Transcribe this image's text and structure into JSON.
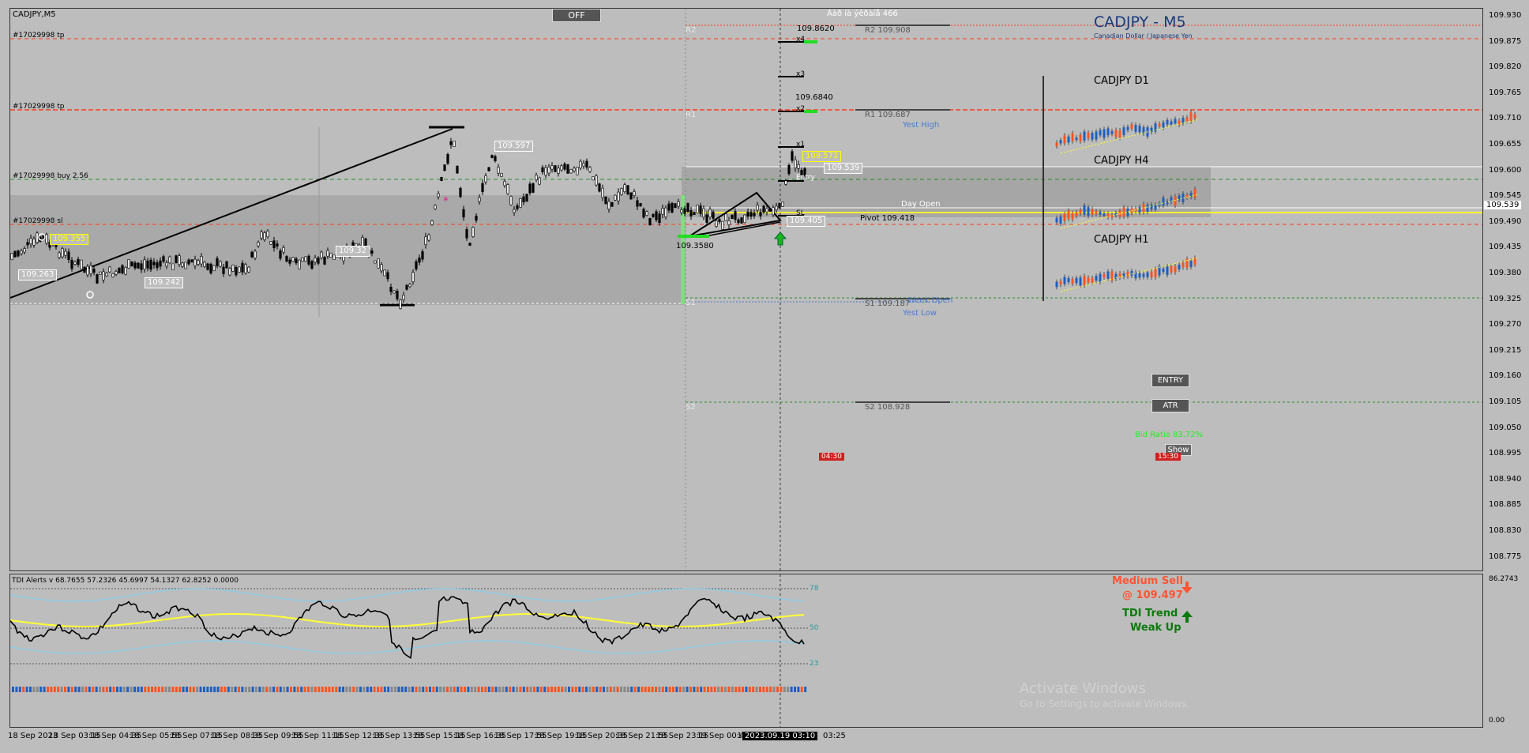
{
  "window": {
    "title": "CADJPY,M5"
  },
  "toolbar": {
    "off_button": "OFF",
    "header_text": "Áàð íà ýêðàíå 466"
  },
  "symbol": {
    "title": "CADJPY - M5",
    "subtitle": "Canadian Dollar / Japanese Yen"
  },
  "orders": {
    "tp1": "#17029998 tp",
    "tp2": "#17029998 tp",
    "buy": "#17029998 buy 2.56",
    "sl": "#17029998 sl"
  },
  "levels": {
    "r2": "R2",
    "r2_label": "R2 109.908",
    "r1": "R1",
    "r1_label": "R1 109.687",
    "s1": "S1",
    "s1_label": "S1 109.187",
    "s2": "S2",
    "s2_label": "S2 108.928",
    "yest_high": "Yest High",
    "yest_low": "Yest Low",
    "week_open": "Week Open",
    "day_open": "Day Open",
    "pivot": "Pivot 109.418"
  },
  "targets": {
    "x4": "x4",
    "x3": "x3",
    "x2": "x2",
    "x1": "x1",
    "t_high": "109.8620",
    "t_mid": "109.6840",
    "t_low": "109.3580",
    "entry": "Entry",
    "sl": "SL"
  },
  "price_tags": {
    "p1": "109.597",
    "p2": "109.355",
    "p3": "109.263",
    "p4": "109.242",
    "p5": "109.32",
    "p6": "109.572",
    "p7": "109.539",
    "p8": "109.405"
  },
  "mini_charts": {
    "d1": "CADJPY D1",
    "h4": "CADJPY H4",
    "h1": "CADJPY H1"
  },
  "buttons": {
    "entry": "ENTRY",
    "atr": "ATR",
    "show": "Show"
  },
  "bid_ratio": "Bid Ratio 83.72%",
  "time_tags": {
    "t1": "04:30",
    "t2": "15:30"
  },
  "signals": {
    "medium_sell": "Medium Sell",
    "sell_price": "@ 109.497",
    "tdi_trend": "TDI Trend",
    "weak_up": "Weak Up"
  },
  "indicator": {
    "label": "TDI Alerts v 68.7655 57.2326 45.6997 54.1327 62.8252 0.0000",
    "lvl_high": "78",
    "lvl_mid": "50",
    "lvl_low": "23",
    "axis_top": "86.2743",
    "axis_bottom": "0.00"
  },
  "current_price": "109.539",
  "y_ticks": [
    "109.930",
    "109.875",
    "109.820",
    "109.765",
    "109.710",
    "109.655",
    "109.600",
    "109.545",
    "109.490",
    "109.435",
    "109.380",
    "109.325",
    "109.270",
    "109.215",
    "109.160",
    "109.105",
    "109.050",
    "108.995",
    "108.940",
    "108.885",
    "108.830",
    "108.775"
  ],
  "x_ticks": [
    "18 Sep 2023",
    "18 Sep 03:15",
    "18 Sep 04:35",
    "18 Sep 05:55",
    "18 Sep 07:15",
    "18 Sep 08:35",
    "18 Sep 09:55",
    "18 Sep 11:15",
    "18 Sep 12:35",
    "18 Sep 13:55",
    "18 Sep 15:15",
    "18 Sep 16:35",
    "18 Sep 17:55",
    "18 Sep 19:15",
    "18 Sep 20:35",
    "18 Sep 21:55",
    "18 Sep 23:15",
    "19 Sep 00:45",
    "19"
  ],
  "x_cursor": "2023.09.19 03:10",
  "x_last": "03:25",
  "watermark": {
    "line1": "Activate Windows",
    "line2": "Go to Settings to activate Windows."
  },
  "colors": {
    "bg": "#bdbdbd",
    "band": "#a9a9a9",
    "red_level": "#ff3b1f",
    "green_level": "#2a8a2a",
    "yellow": "#ffff33",
    "signal_red": "#ff5533",
    "signal_green": "#0a7a0a"
  }
}
